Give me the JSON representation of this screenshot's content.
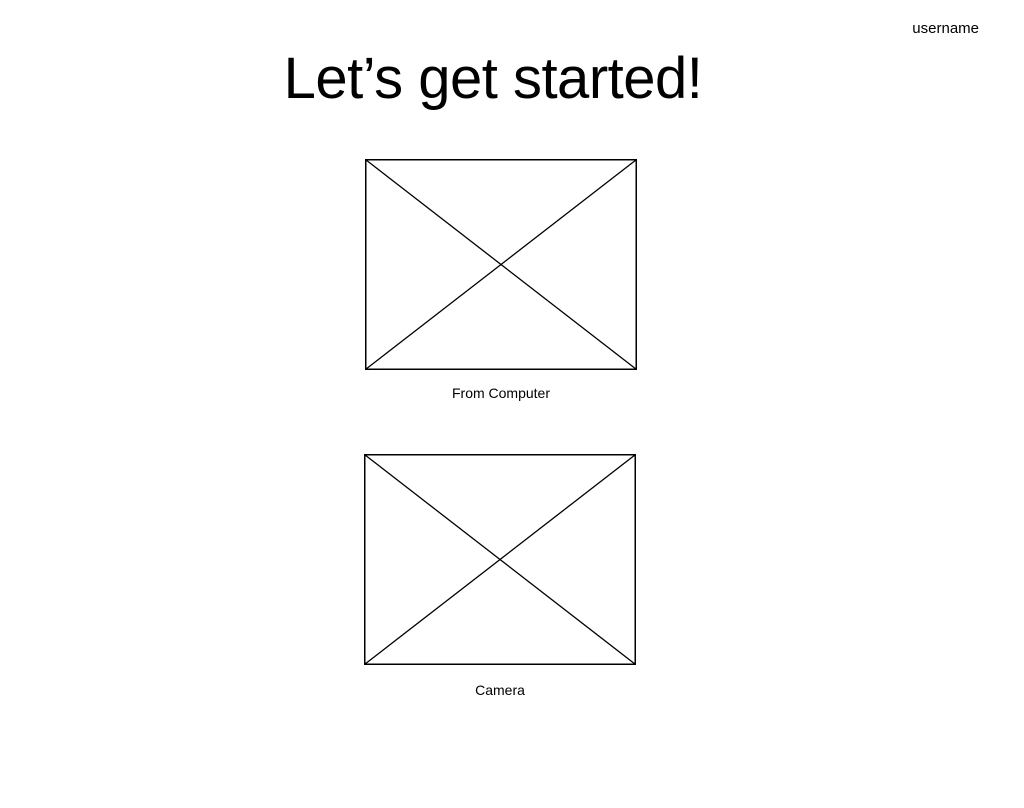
{
  "header": {
    "username": "username"
  },
  "main": {
    "title": "Let’s get started!",
    "options": [
      {
        "id": "from-computer",
        "label": "From Computer"
      },
      {
        "id": "camera",
        "label": "Camera"
      }
    ]
  },
  "colors": {
    "background": "#ffffff",
    "foreground": "#000000"
  }
}
